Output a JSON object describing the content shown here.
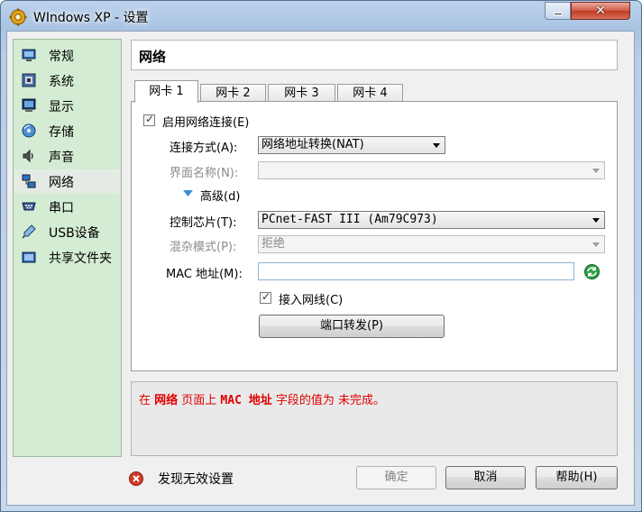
{
  "window": {
    "title": "WIndows XP - 设置",
    "minimize_glyph": "",
    "close_glyph": "✕"
  },
  "sidebar": {
    "items": [
      {
        "label": "常规",
        "icon": "monitor-general-icon"
      },
      {
        "label": "系统",
        "icon": "system-board-icon"
      },
      {
        "label": "显示",
        "icon": "display-icon"
      },
      {
        "label": "存储",
        "icon": "storage-disk-icon"
      },
      {
        "label": "声音",
        "icon": "speaker-icon"
      },
      {
        "label": "网络",
        "icon": "network-icon",
        "active": true
      },
      {
        "label": "串口",
        "icon": "serial-port-icon"
      },
      {
        "label": "USB设备",
        "icon": "usb-icon"
      },
      {
        "label": "共享文件夹",
        "icon": "shared-folder-icon"
      }
    ]
  },
  "panel": {
    "title": "网络"
  },
  "tabs": [
    {
      "label": "网卡 1",
      "active": true
    },
    {
      "label": "网卡 2"
    },
    {
      "label": "网卡 3"
    },
    {
      "label": "网卡 4"
    }
  ],
  "form": {
    "enable_label": "启用网络连接(E)",
    "attach_label": "连接方式(A):",
    "attach_value": "网络地址转换(NAT)",
    "name_label": "界面名称(N):",
    "name_value": "",
    "advanced_label": "高级(d)",
    "adapter_label": "控制芯片(T):",
    "adapter_value": "PCnet-FAST III (Am79C973)",
    "promisc_label": "混杂模式(P):",
    "promisc_value": "拒绝",
    "mac_label": "MAC 地址(M):",
    "mac_value": "",
    "cable_label": "接入网线(C)",
    "port_forward_label": "端口转发(P)"
  },
  "message": {
    "prefix": "在 ",
    "page": "网络",
    "middle": " 页面上 ",
    "field": "MAC 地址",
    "suffix": " 字段的值为 未完成。"
  },
  "footer": {
    "status_text": "发现无效设置",
    "ok_label": "确定",
    "cancel_label": "取消",
    "help_label": "帮助(H)"
  },
  "colors": {
    "sidebar_bg": "#d4ecd4",
    "error_red": "#e00000",
    "accent_blue": "#3a76c8"
  }
}
